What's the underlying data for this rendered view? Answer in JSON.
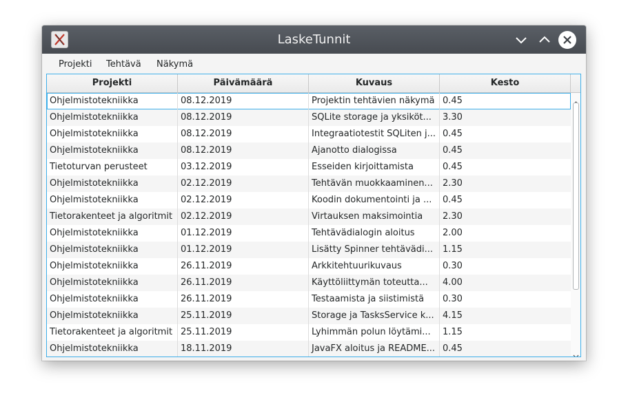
{
  "window": {
    "title": "LaskeTunnit",
    "icons": {
      "app": "app-x-icon",
      "minimize": "chevron-down-icon",
      "maximize": "chevron-up-icon",
      "close": "close-icon"
    }
  },
  "menubar": {
    "items": [
      "Projekti",
      "Tehtävä",
      "Näkymä"
    ]
  },
  "table": {
    "columns": [
      "Projekti",
      "Päivämäärä",
      "Kuvaus",
      "Kesto"
    ],
    "selected_row": 0,
    "rows": [
      [
        "Ohjelmistotekniikka",
        "08.12.2019",
        "Projektin tehtävien näkymä",
        "0.45"
      ],
      [
        "Ohjelmistotekniikka",
        "08.12.2019",
        "SQLite storage ja yksiköt...",
        "3.30"
      ],
      [
        "Ohjelmistotekniikka",
        "08.12.2019",
        "Integraatiotestit SQLiten j...",
        "0.45"
      ],
      [
        "Ohjelmistotekniikka",
        "08.12.2019",
        "Ajanotto dialogissa",
        "0.45"
      ],
      [
        "Tietoturvan perusteet",
        "03.12.2019",
        "Esseiden kirjoittamista",
        "0.45"
      ],
      [
        "Ohjelmistotekniikka",
        "02.12.2019",
        "Tehtävän muokkaaminen...",
        "2.30"
      ],
      [
        "Ohjelmistotekniikka",
        "02.12.2019",
        "Koodin dokumentointi ja ...",
        "0.45"
      ],
      [
        "Tietorakenteet ja algoritmit",
        "02.12.2019",
        "Virtauksen maksimointia",
        "2.30"
      ],
      [
        "Ohjelmistotekniikka",
        "01.12.2019",
        "Tehtävädialogin aloitus",
        "2.00"
      ],
      [
        "Ohjelmistotekniikka",
        "01.12.2019",
        "Lisätty Spinner tehtävädi...",
        "1.15"
      ],
      [
        "Ohjelmistotekniikka",
        "26.11.2019",
        "Arkkitehtuurikuvaus",
        "0.30"
      ],
      [
        "Ohjelmistotekniikka",
        "26.11.2019",
        "Käyttöliittymän toteutta...",
        "4.00"
      ],
      [
        "Ohjelmistotekniikka",
        "26.11.2019",
        "Testaamista ja siistimistä",
        "0.30"
      ],
      [
        "Ohjelmistotekniikka",
        "25.11.2019",
        "Storage ja TasksService k...",
        "4.15"
      ],
      [
        "Tietorakenteet ja algoritmit",
        "25.11.2019",
        "Lyhimmän polun löytämi...",
        "1.15"
      ],
      [
        "Ohjelmistotekniikka",
        "18.11.2019",
        "JavaFX aloitus ja README...",
        "0.45"
      ]
    ]
  },
  "colors": {
    "titlebar": "#4f5359",
    "accent": "#3daee9",
    "row_alt": "#f5f5f5"
  }
}
